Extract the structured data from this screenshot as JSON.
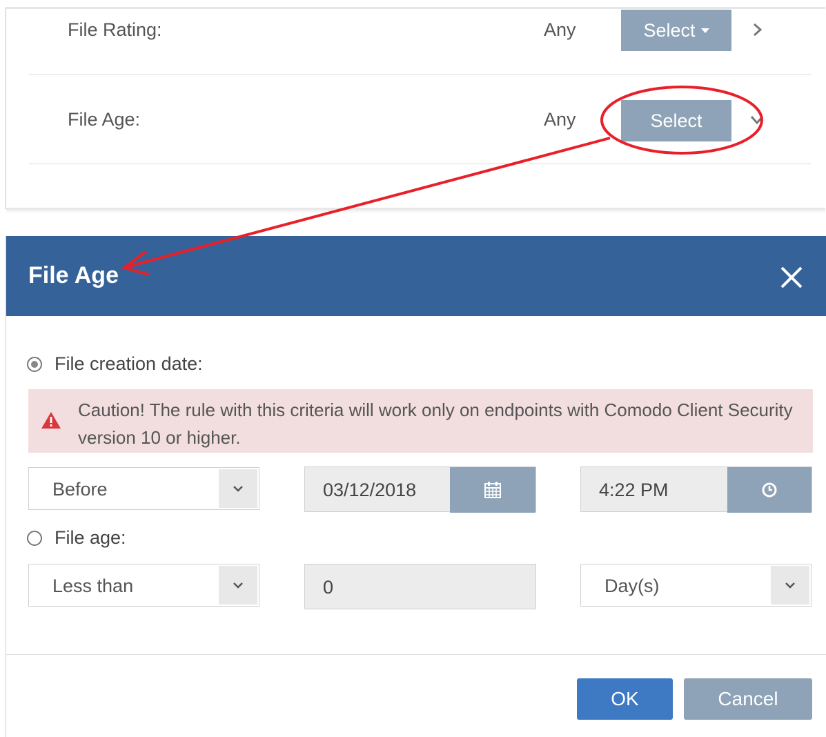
{
  "background": {
    "rows": [
      {
        "label": "File Rating:",
        "value": "Any",
        "button": "Select"
      },
      {
        "label": "File Age:",
        "value": "Any",
        "button": "Select"
      }
    ]
  },
  "dialog": {
    "title": "File Age",
    "creation_option": {
      "label": "File creation date:",
      "checked": true
    },
    "caution": "Caution! The rule with this criteria will work only on endpoints with Comodo Client Security version 10 or higher.",
    "creation_comparison": "Before",
    "date": "03/12/2018",
    "time": "4:22 PM",
    "age_option": {
      "label": "File age:",
      "checked": false
    },
    "age_comparison": "Less than",
    "age_value": "0",
    "age_unit": "Day(s)",
    "ok_label": "OK",
    "cancel_label": "Cancel"
  },
  "icons": [
    "calendar-icon",
    "clock-icon",
    "warning-icon",
    "close-icon",
    "chevron-down-icon",
    "chevron-right-icon"
  ],
  "colors": {
    "header": "#356299",
    "select_button": "#8ea3b7",
    "ok_button": "#3e7ac3",
    "cancel_button": "#8ea3b7",
    "alert_bg": "#f2dede",
    "alert_icon": "#d9363e",
    "annotation": "#e8202a"
  }
}
